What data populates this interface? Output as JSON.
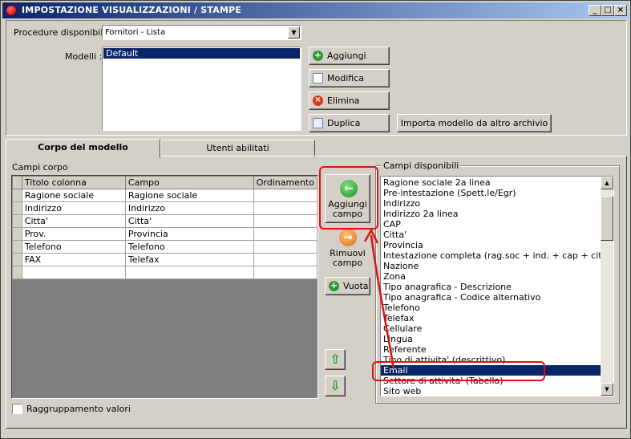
{
  "window": {
    "title": "IMPOSTAZIONE VISUALIZZAZIONI / STAMPE",
    "controls": {
      "minimize": "_",
      "maximize": "□",
      "close": "×"
    }
  },
  "top": {
    "procedure_label": "Procedure disponibili :",
    "procedure_value": "Fornitori - Lista",
    "models_label": "Modelli :",
    "models": [
      "Default"
    ],
    "buttons": {
      "add": "Aggiungi",
      "modify": "Modifica",
      "delete": "Elimina",
      "duplicate": "Duplica",
      "import": "Importa modello da altro archivio"
    }
  },
  "tabs": [
    {
      "label": "Corpo del modello",
      "active": true
    },
    {
      "label": "Utenti abilitati",
      "active": false
    }
  ],
  "body": {
    "group_label": "Campi corpo",
    "columns": [
      "Titolo colonna",
      "Campo",
      "Ordinamento"
    ],
    "rows": [
      [
        "Ragione sociale",
        "Ragione sociale",
        ""
      ],
      [
        "Indirizzo",
        "Indirizzo",
        ""
      ],
      [
        "Citta'",
        "Citta'",
        ""
      ],
      [
        "Prov.",
        "Provincia",
        ""
      ],
      [
        "Telefono",
        "Telefono",
        ""
      ],
      [
        "FAX",
        "Telefax",
        ""
      ],
      [
        "",
        "",
        ""
      ]
    ],
    "add_field_line1": "Aggiungi",
    "add_field_line2": "campo",
    "remove_field_line1": "Rimuovi",
    "remove_field_line2": "campo",
    "empty_button": "Vuota",
    "group_values_label": "Raggruppamento valori"
  },
  "available": {
    "label": "Campi disponibili",
    "items": [
      "Ragione sociale 2a linea",
      "Pre-intestazione (Spett.le/Egr)",
      "Indirizzo",
      "Indirizzo 2a linea",
      "CAP",
      "Citta'",
      "Provincia",
      "Intestazione completa (rag.soc + ind. + cap + citta + prov)",
      "Nazione",
      "Zona",
      "Tipo anagrafica - Descrizione",
      "Tipo anagrafica - Codice alternativo",
      "Telefono",
      "Telefax",
      "Cellulare",
      "Lingua",
      "Referente",
      "Tipo di attivita' (descrittivo)",
      "Email",
      "Settore di attivita' (Tabella)",
      "Sito web"
    ],
    "selected_index": 18
  },
  "icons": {
    "title": "app-icon",
    "add": "plus-circle-icon",
    "modify": "edit-icon",
    "delete": "delete-icon",
    "duplicate": "duplicate-icon",
    "add_field": "arrow-left-icon",
    "remove_field": "arrow-right-icon",
    "up": "arrow-up-icon",
    "down": "arrow-down-icon"
  },
  "colors": {
    "selection": "#0a246a",
    "annotation": "#e01010",
    "window_bg": "#d4d0c8"
  }
}
